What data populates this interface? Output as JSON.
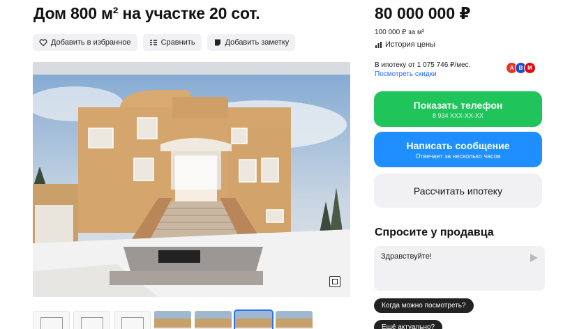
{
  "listing": {
    "title": "Дом 800 м² на участке 20 сот.",
    "actions": {
      "favorite": "Добавить в избранное",
      "compare": "Сравнить",
      "note": "Добавить заметку"
    }
  },
  "price": {
    "value": "80 000 000 ₽",
    "per_sqm": "100 000 ₽ за м²",
    "history_label": "История цены"
  },
  "mortgage": {
    "line": "В ипотеку от 1 075 746 ₽/мес.",
    "link": "Посмотреть скидки",
    "banks": [
      {
        "name": "alfa-bank-icon",
        "glyph": "А",
        "color": "#ef3124"
      },
      {
        "name": "vtb-bank-icon",
        "glyph": "В",
        "color": "#1e4bd2"
      },
      {
        "name": "mts-bank-icon",
        "glyph": "М",
        "color": "#e30611"
      }
    ]
  },
  "buttons": {
    "phone_label": "Показать телефон",
    "phone_number": "8 934 XXX-XX-XX",
    "message_label": "Написать сообщение",
    "message_sub": "Отвечает за несколько часов",
    "calc_label": "Рассчитать ипотеку"
  },
  "ask": {
    "title": "Спросите у продавца",
    "input_value": "Здравствуйте!",
    "chips": [
      "Когда можно посмотреть?",
      "Ещё актуально?"
    ]
  },
  "colors": {
    "phone": "#1fc45a",
    "message": "#1f8fff",
    "link": "#1f6bff"
  }
}
